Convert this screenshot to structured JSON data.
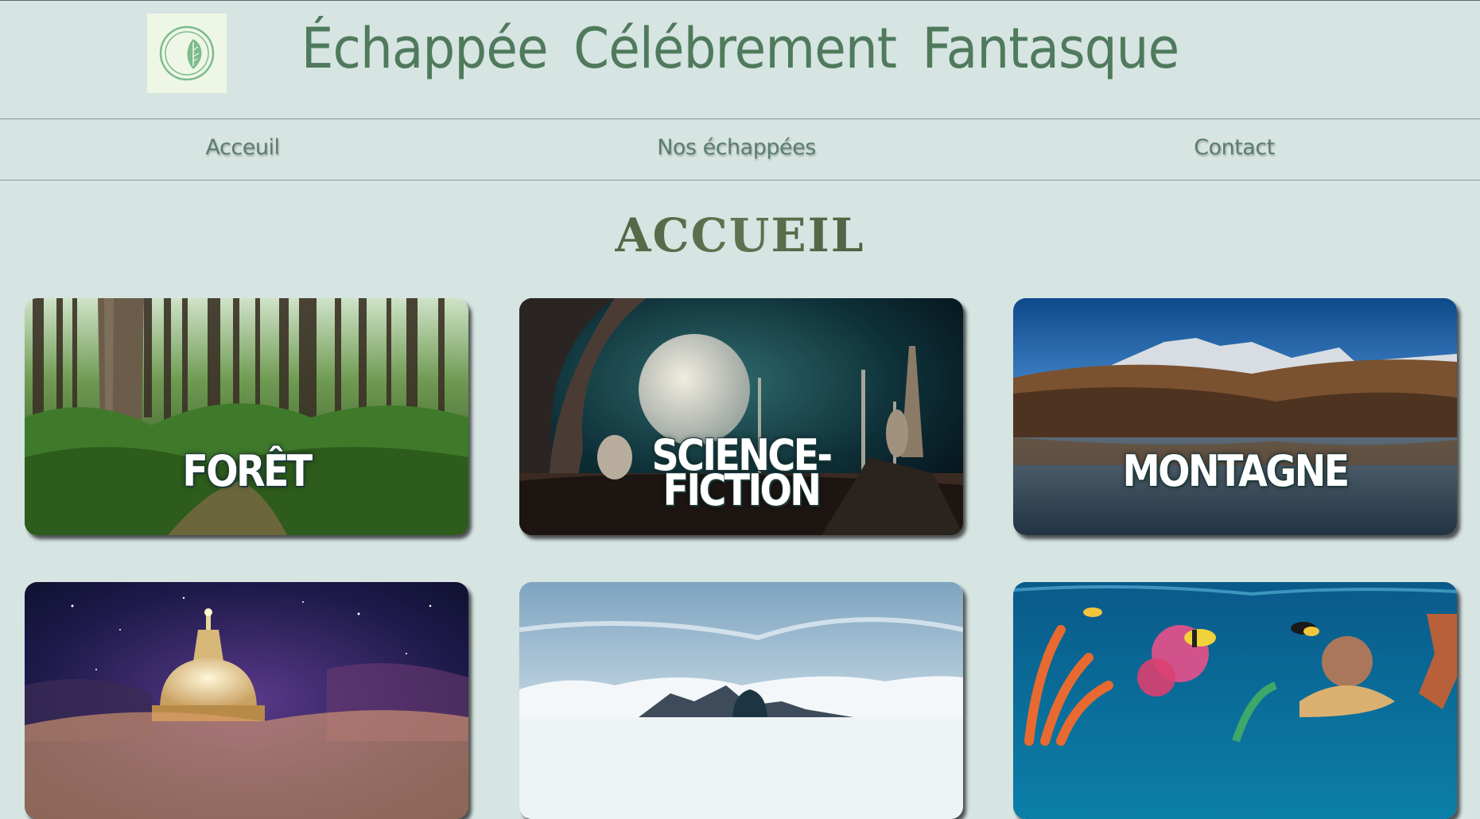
{
  "header": {
    "site_title": "Échappée Célébrement Fantasque"
  },
  "nav": {
    "items": [
      {
        "label": "Acceuil"
      },
      {
        "label": "Nos échappées"
      },
      {
        "label": "Contact"
      }
    ]
  },
  "main": {
    "heading": "ACCUEIL",
    "cards": [
      {
        "label": "FORÊT",
        "scene": "forest"
      },
      {
        "label_line1": "SCIENCE-",
        "label_line2": "FICTION",
        "scene": "science-fiction"
      },
      {
        "label": "MONTAGNE",
        "scene": "mountain"
      },
      {
        "label": "",
        "scene": "fantasy-dome"
      },
      {
        "label": "",
        "scene": "snow-hiker"
      },
      {
        "label": "",
        "scene": "coral-reef"
      }
    ]
  },
  "colors": {
    "background": "#d6e4e2",
    "title_green": "#4f7a5c",
    "nav_green": "#5b7e6c"
  }
}
